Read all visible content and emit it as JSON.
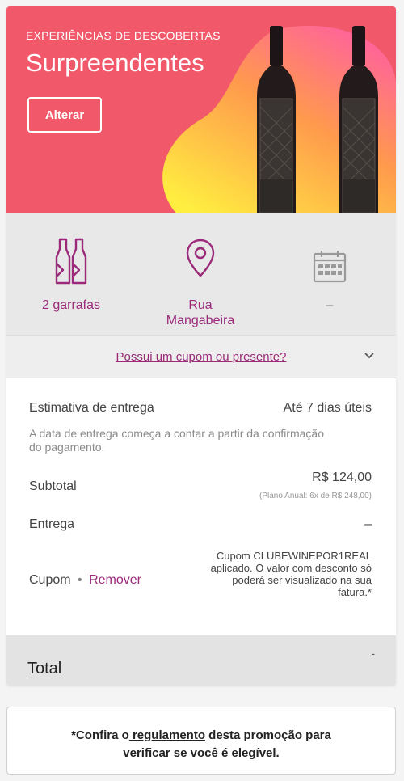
{
  "hero": {
    "kicker": "EXPERIÊNCIAS DE DESCOBERTAS",
    "title": "Surpreendentes",
    "change_button": "Alterar",
    "colors": {
      "background": "#f1586a",
      "blob_start": "#ff6f91",
      "blob_end": "#ffe34d"
    }
  },
  "info": {
    "bottles": {
      "icon": "wine-bottles-icon",
      "label": "2 garrafas"
    },
    "address": {
      "icon": "map-pin-icon",
      "label_line1": "Rua",
      "label_line2": "Mangabeira"
    },
    "date": {
      "icon": "calendar-icon",
      "label": "–"
    }
  },
  "coupon_link": "Possui um cupom ou presente?",
  "summary": {
    "delivery_estimate_label": "Estimativa de entrega",
    "delivery_estimate_value": "Até 7 dias úteis",
    "delivery_note": "A data de entrega começa a contar a partir da confirmação do pagamento.",
    "subtotal_label": "Subtotal",
    "subtotal_value": "R$ 124,00",
    "plan_note": "(Plano Anual: 6x de  R$  248,00)",
    "shipping_label": "Entrega",
    "shipping_value": "–",
    "coupon_label": "Cupom",
    "coupon_separator": "•",
    "coupon_remove": "Remover",
    "coupon_message": "Cupom CLUBEWINEPOR1REAL aplicado. O valor com desconto só poderá ser visualizado na sua fatura.*"
  },
  "total": {
    "label": "Total",
    "value": "-"
  },
  "promo": {
    "line1_prefix": "*Confira o",
    "line1_link": " regulamento",
    "line1_suffix": " desta promoção para",
    "line2": "verificar se você é elegível."
  },
  "accent_color": "#9b2a7b"
}
